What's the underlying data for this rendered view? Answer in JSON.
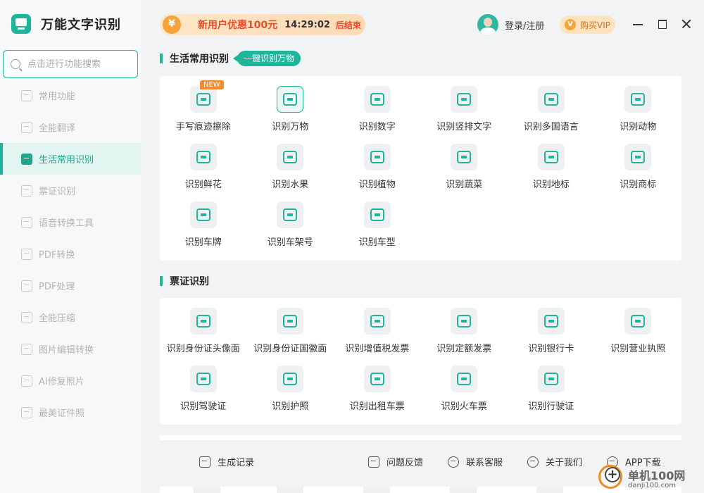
{
  "app": {
    "title": "万能文字识别"
  },
  "search": {
    "placeholder": "点击进行功能搜索"
  },
  "sidebar": {
    "items": [
      {
        "label": "常用功能",
        "icon": "scan-icon"
      },
      {
        "label": "全能翻译",
        "icon": "translate-icon"
      },
      {
        "label": "生活常用识别",
        "icon": "scanner-icon"
      },
      {
        "label": "票证识别",
        "icon": "ticket-icon"
      },
      {
        "label": "语音转换工具",
        "icon": "voice-icon"
      },
      {
        "label": "PDF转换",
        "icon": "pdf-convert-icon"
      },
      {
        "label": "PDF处理",
        "icon": "pdf-edit-icon"
      },
      {
        "label": "全能压缩",
        "icon": "compress-icon"
      },
      {
        "label": "图片编辑转换",
        "icon": "image-edit-icon"
      },
      {
        "label": "AI修复照片",
        "icon": "ai-repair-icon"
      },
      {
        "label": "最美证件照",
        "icon": "id-photo-icon"
      }
    ],
    "active_index": 2
  },
  "promo": {
    "text": "新用户优惠100元",
    "time": "14:29:02",
    "end_label": "后结束"
  },
  "user": {
    "login_label": "登录/注册"
  },
  "vip": {
    "badge": "V",
    "label": "购买VIP"
  },
  "sections": {
    "life": {
      "title": "生活常用识别",
      "tag": "一键识别万物",
      "items": [
        {
          "label": "手写痕迹擦除",
          "icon": "eraser-icon",
          "badge": "NEW"
        },
        {
          "label": "识别万物",
          "icon": "eye-scan-icon"
        },
        {
          "label": "识别数字",
          "icon": "digit-scan-icon"
        },
        {
          "label": "识别竖排文字",
          "icon": "vertical-text-icon"
        },
        {
          "label": "识别多国语言",
          "icon": "multilang-icon"
        },
        {
          "label": "识别动物",
          "icon": "animal-icon"
        },
        {
          "label": "识别鲜花",
          "icon": "flower-icon"
        },
        {
          "label": "识别水果",
          "icon": "fruit-icon"
        },
        {
          "label": "识别植物",
          "icon": "plant-icon"
        },
        {
          "label": "识别蔬菜",
          "icon": "vegetable-icon"
        },
        {
          "label": "识别地标",
          "icon": "landmark-icon"
        },
        {
          "label": "识别商标",
          "icon": "trademark-icon"
        },
        {
          "label": "识别车牌",
          "icon": "car-plate-icon"
        },
        {
          "label": "识别车架号",
          "icon": "vin-icon"
        },
        {
          "label": "识别车型",
          "icon": "car-model-icon"
        }
      ]
    },
    "ticket": {
      "title": "票证识别",
      "items": [
        {
          "label": "识别身份证头像面",
          "icon": "id-front-icon"
        },
        {
          "label": "识别身份证国徽面",
          "icon": "id-back-icon"
        },
        {
          "label": "识别增值税发票",
          "icon": "vat-invoice-icon"
        },
        {
          "label": "识别定额发票",
          "icon": "quota-invoice-icon"
        },
        {
          "label": "识别银行卡",
          "icon": "bank-card-icon"
        },
        {
          "label": "识别营业执照",
          "icon": "business-license-icon"
        },
        {
          "label": "识别驾驶证",
          "icon": "driver-license-icon"
        },
        {
          "label": "识别护照",
          "icon": "passport-icon"
        },
        {
          "label": "识别出租车票",
          "icon": "taxi-ticket-icon"
        },
        {
          "label": "识别火车票",
          "icon": "train-ticket-icon"
        },
        {
          "label": "识别行驶证",
          "icon": "vehicle-license-icon"
        }
      ]
    }
  },
  "bottom_bar": {
    "history": "生成记录",
    "feedback": "问题反馈",
    "service": "联系客服",
    "about": "关于我们",
    "app_download": "APP下载"
  },
  "watermark": {
    "line1": "单机100网",
    "line2": "danji100.com"
  }
}
